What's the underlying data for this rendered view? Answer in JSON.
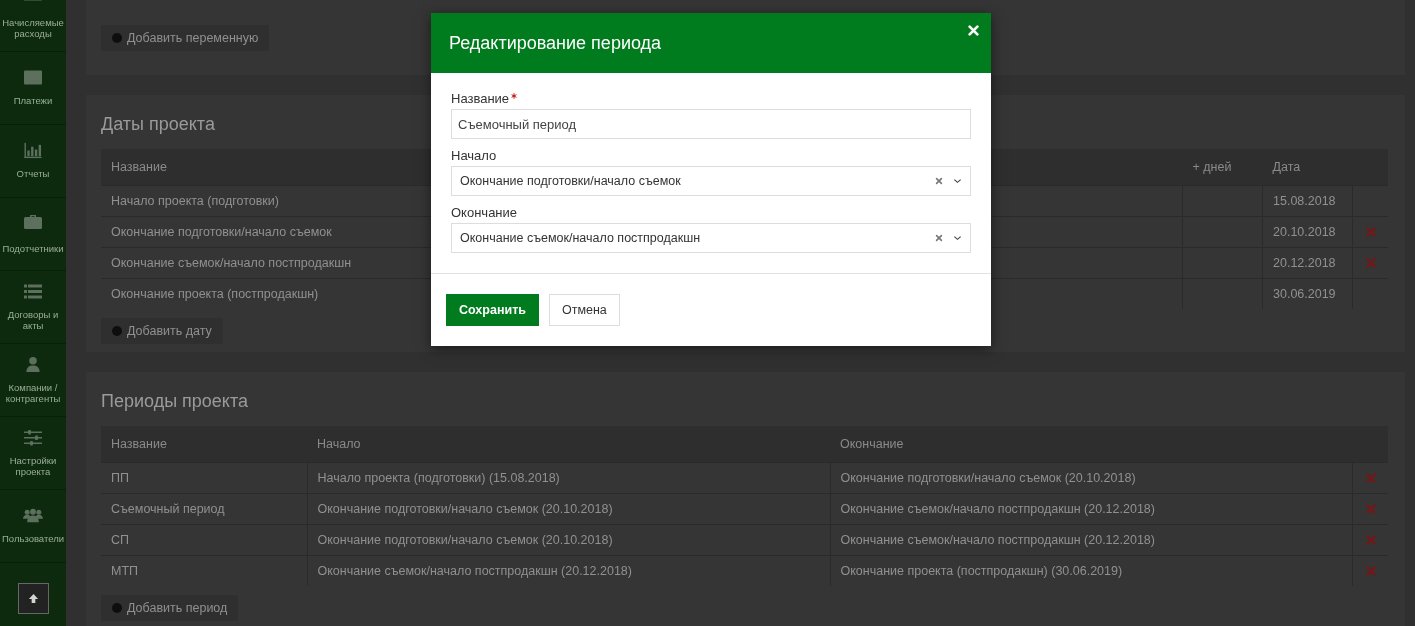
{
  "sidebar": {
    "items": [
      {
        "label": "Начисляемые расходы"
      },
      {
        "label": "Платежи"
      },
      {
        "label": "Отчеты"
      },
      {
        "label": "Подотчетники"
      },
      {
        "label": "Договоры и акты"
      },
      {
        "label": "Компании / контрагенты"
      },
      {
        "label": "Настройки проекта"
      },
      {
        "label": "Пользователи"
      }
    ]
  },
  "variables": {
    "add_button": "Добавить переменную"
  },
  "dates": {
    "title": "Даты проекта",
    "columns": [
      "Название",
      "+ дней",
      "Дата"
    ],
    "rows": [
      {
        "name": "Начало проекта (подготовки)",
        "days": "",
        "date": "15.08.2018",
        "deletable": false
      },
      {
        "name": "Окончание подготовки/начало съемок",
        "days": "",
        "date": "20.10.2018",
        "deletable": true
      },
      {
        "name": "Окончание съемок/начало постпродакшн",
        "days": "",
        "date": "20.12.2018",
        "deletable": true
      },
      {
        "name": "Окончание проекта (постпродакшн)",
        "days": "",
        "date": "30.06.2019",
        "deletable": false
      }
    ],
    "add_button": "Добавить дату"
  },
  "periods": {
    "title": "Периоды проекта",
    "columns": [
      "Название",
      "Начало",
      "Окончание"
    ],
    "rows": [
      {
        "name": "ПП",
        "start": "Начало проекта (подготовки) (15.08.2018)",
        "end": "Окончание подготовки/начало съемок (20.10.2018)"
      },
      {
        "name": "Съемочный период",
        "start": "Окончание подготовки/начало съемок (20.10.2018)",
        "end": "Окончание съемок/начало постпродакшн (20.12.2018)"
      },
      {
        "name": "СП",
        "start": "Окончание подготовки/начало съемок (20.10.2018)",
        "end": "Окончание съемок/начало постпродакшн (20.12.2018)"
      },
      {
        "name": "МТП",
        "start": "Окончание съемок/начало постпродакшн (20.12.2018)",
        "end": "Окончание проекта (постпродакшн) (30.06.2019)"
      }
    ],
    "add_button": "Добавить период"
  },
  "modal": {
    "title": "Редактирование периода",
    "fields": [
      {
        "label": "Название",
        "required": true,
        "kind": "text",
        "value": "Съемочный период"
      },
      {
        "label": "Начало",
        "required": false,
        "kind": "select",
        "value": "Окончание подготовки/начало съемок"
      },
      {
        "label": "Окончание",
        "required": false,
        "kind": "select",
        "value": "Окончание съемок/начало постпродакшн"
      }
    ],
    "buttons": [
      {
        "label": "Сохранить",
        "primary": true
      },
      {
        "label": "Отмена",
        "primary": false
      }
    ]
  }
}
